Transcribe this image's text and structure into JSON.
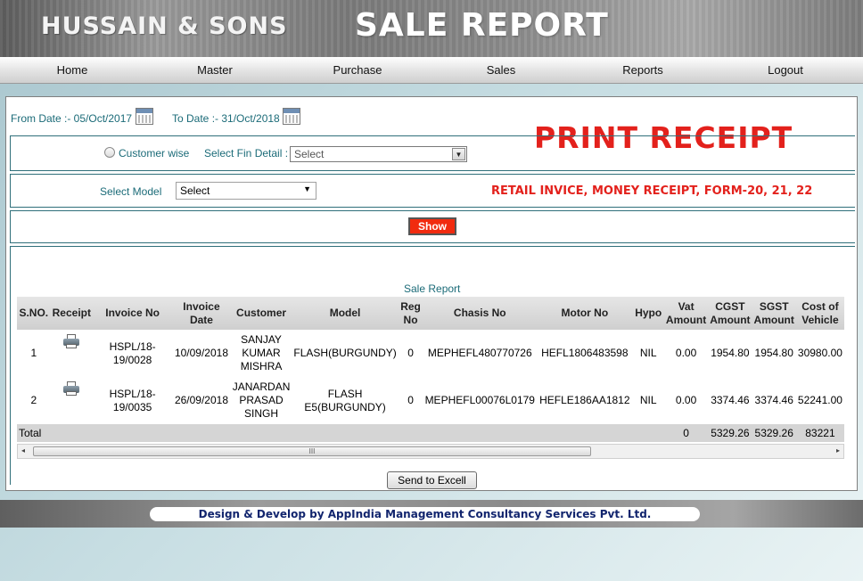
{
  "header": {
    "brand": "HUSSAIN & SONS",
    "title": "SALE REPORT"
  },
  "nav": {
    "items": [
      "Home",
      "Master",
      "Purchase",
      "Sales",
      "Reports",
      "Logout"
    ]
  },
  "filters": {
    "from_date": "From Date :- 05/Oct/2017",
    "to_date": "To Date :- 31/Oct/2018",
    "customer_wise": "Customer wise",
    "fin_detail_label": "Select Fin Detail :",
    "fin_detail_value": "Select",
    "model_label": "Select Model",
    "model_value": "Select",
    "show_button": "Show"
  },
  "annotations": {
    "print_receipt": "PRINT RECEIPT",
    "retail": "RETAIL INVICE, MONEY RECEIPT, FORM-20, 21, 22"
  },
  "report": {
    "caption": "Sale Report",
    "columns": [
      "S.NO.",
      "Receipt",
      "Invoice No",
      "Invoice Date",
      "Customer",
      "Model",
      "Reg No",
      "Chasis No",
      "Motor No",
      "Hypo",
      "Vat Amount",
      "CGST Amount",
      "SGST Amount",
      "Cost of Vehicle"
    ],
    "rows": [
      {
        "sno": "1",
        "invoice_no": "HSPL/18-19/0028",
        "invoice_date": "10/09/2018",
        "customer": "SANJAY KUMAR MISHRA",
        "model": "FLASH(BURGUNDY)",
        "reg_no": "0",
        "chasis_no": "MEPHEFL480770726",
        "motor_no": "HEFL1806483598",
        "hypo": "NIL",
        "vat": "0.00",
        "cgst": "1954.80",
        "sgst": "1954.80",
        "cost": "30980.00"
      },
      {
        "sno": "2",
        "invoice_no": "HSPL/18-19/0035",
        "invoice_date": "26/09/2018",
        "customer": "JANARDAN PRASAD SINGH",
        "model": "FLASH E5(BURGUNDY)",
        "reg_no": "0",
        "chasis_no": "MEPHEFL00076L0179",
        "motor_no": "HEFLE186AA1812",
        "hypo": "NIL",
        "vat": "0.00",
        "cgst": "3374.46",
        "sgst": "3374.46",
        "cost": "52241.00"
      }
    ],
    "total": {
      "label": "Total",
      "vat": "0",
      "cgst": "5329.26",
      "sgst": "5329.26",
      "cost": "83221"
    },
    "scroll_grip": "III",
    "scroll_left": "◂",
    "scroll_right": "▸"
  },
  "actions": {
    "excel_button": "Send to Excell"
  },
  "footer": {
    "credit": "Design & Develop by AppIndia Management Consultancy Services Pvt. Ltd."
  },
  "colors": {
    "accent_red": "#e3211c",
    "teal_text": "#1b6b78",
    "footer_text": "#12256e"
  }
}
